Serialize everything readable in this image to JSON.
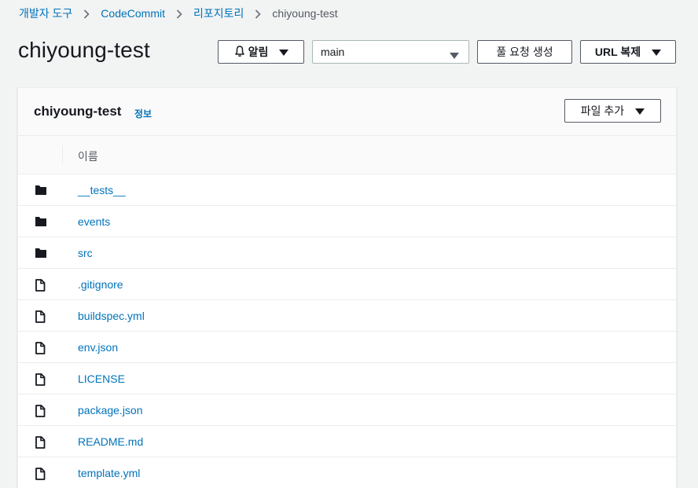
{
  "breadcrumb": {
    "items": [
      "개발자 도구",
      "CodeCommit",
      "리포지토리"
    ],
    "current": "chiyoung-test"
  },
  "header": {
    "title": "chiyoung-test",
    "notify_label": "알림",
    "branch_value": "main",
    "pull_request_label": "풀 요청 생성",
    "clone_url_label": "URL 복제"
  },
  "panel": {
    "title": "chiyoung-test",
    "info_label": "정보",
    "add_file_label": "파일 추가",
    "column_name": "이름",
    "files": [
      {
        "name": "__tests__",
        "type": "folder"
      },
      {
        "name": "events",
        "type": "folder"
      },
      {
        "name": "src",
        "type": "folder"
      },
      {
        "name": ".gitignore",
        "type": "file"
      },
      {
        "name": "buildspec.yml",
        "type": "file"
      },
      {
        "name": "env.json",
        "type": "file"
      },
      {
        "name": "LICENSE",
        "type": "file"
      },
      {
        "name": "package.json",
        "type": "file"
      },
      {
        "name": "README.md",
        "type": "file"
      },
      {
        "name": "template.yml",
        "type": "file"
      }
    ]
  },
  "colors": {
    "link": "#0073bb",
    "background": "#f2f3f3",
    "text": "#16191f"
  }
}
